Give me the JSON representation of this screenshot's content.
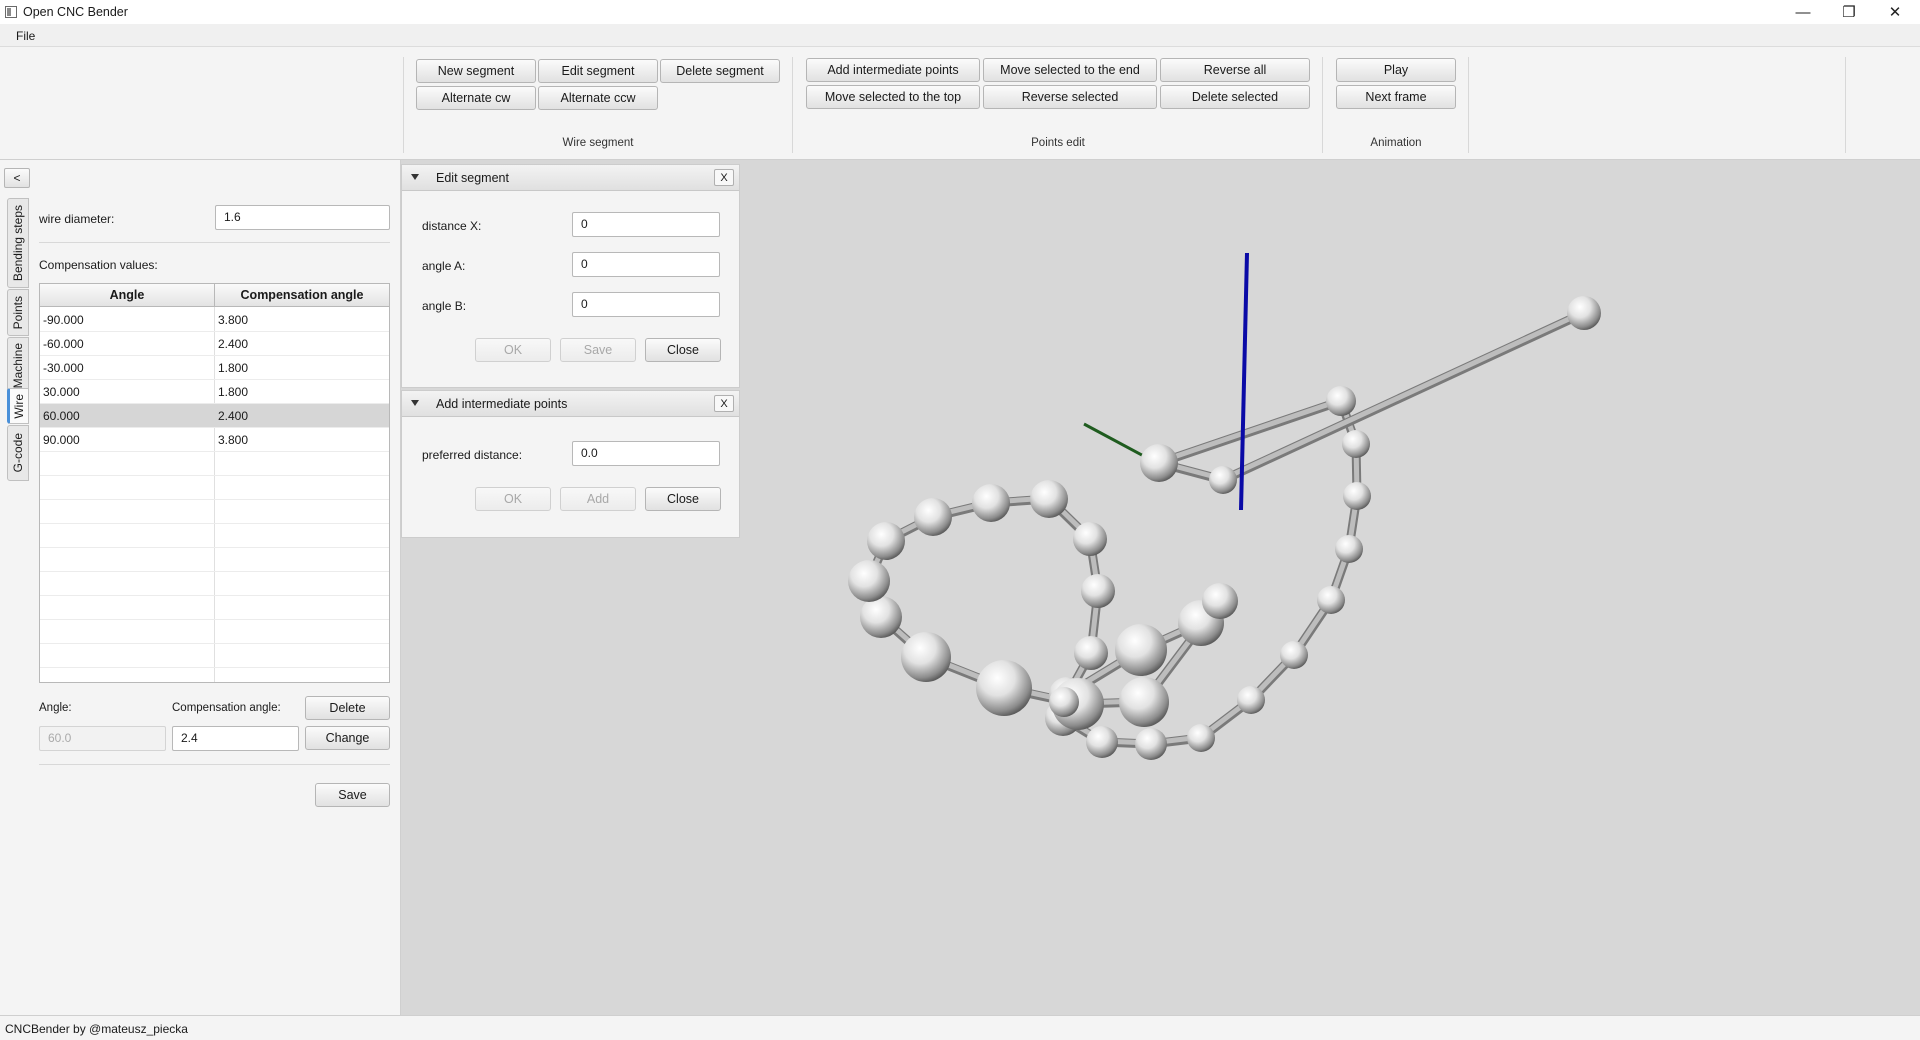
{
  "window": {
    "title": "Open CNC Bender",
    "minimize_glyph": "—",
    "restore_glyph": "❐",
    "close_glyph": "✕"
  },
  "menu": {
    "file": "File"
  },
  "ribbon": {
    "wire_segment": {
      "label": "Wire segment",
      "new_segment": "New segment",
      "edit_segment": "Edit segment",
      "delete_segment": "Delete segment",
      "alternate_cw": "Alternate cw",
      "alternate_ccw": "Alternate ccw"
    },
    "points_edit": {
      "label": "Points edit",
      "add_intermediate_points": "Add intermediate points",
      "move_selected_to_end": "Move selected to the end",
      "reverse_all": "Reverse all",
      "move_selected_to_top": "Move selected to the top",
      "reverse_selected": "Reverse selected",
      "delete_selected": "Delete selected"
    },
    "animation": {
      "label": "Animation",
      "play": "Play",
      "next_frame": "Next frame"
    }
  },
  "left_panel": {
    "collapse_glyph": "<",
    "tabs": [
      "Bending steps",
      "Points",
      "Machine",
      "Wire",
      "G-code"
    ],
    "active_tab": "Wire",
    "wire_diameter_label": "wire diameter:",
    "wire_diameter_value": "1.6",
    "compensation_label": "Compensation values:",
    "table": {
      "columns": [
        "Angle",
        "Compensation angle"
      ],
      "rows": [
        [
          "-90.000",
          "3.800"
        ],
        [
          "-60.000",
          "2.400"
        ],
        [
          "-30.000",
          "1.800"
        ],
        [
          "30.000",
          "1.800"
        ],
        [
          "60.000",
          "2.400"
        ],
        [
          "90.000",
          "3.800"
        ]
      ],
      "selected_row": 4
    },
    "angle_label": "Angle:",
    "compensation_angle_label": "Compensation angle:",
    "angle_value": "60.0",
    "compensation_angle_value": "2.4",
    "delete_button": "Delete",
    "change_button": "Change",
    "save_button": "Save"
  },
  "edit_segment": {
    "title": "Edit segment",
    "close_x": "X",
    "distance_x_label": "distance X:",
    "distance_x_value": "0",
    "angle_a_label": "angle A:",
    "angle_a_value": "0",
    "angle_b_label": "angle B:",
    "angle_b_value": "0",
    "ok": "OK",
    "save": "Save",
    "close": "Close"
  },
  "add_points": {
    "title": "Add intermediate points",
    "close_x": "X",
    "preferred_distance_label": "preferred distance:",
    "preferred_distance_value": "0.0",
    "ok": "OK",
    "add": "Add",
    "close": "Close"
  },
  "status": {
    "text": "CNCBender by @mateusz_piecka"
  },
  "colors": {
    "viewport_bg": "#d7d7d7",
    "axis_z": "#0a0aa6",
    "axis_y": "#1f5c1f",
    "wire": "#bdbdbd",
    "selected_row": "#d6d6d6"
  }
}
